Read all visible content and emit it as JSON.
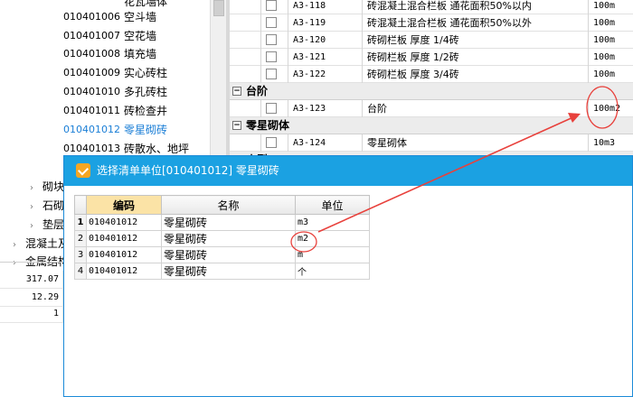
{
  "left_tree": {
    "rows": [
      {
        "code": "",
        "name": "花瓦墙体"
      },
      {
        "code": "010401006",
        "name": "空斗墙"
      },
      {
        "code": "010401007",
        "name": "空花墙"
      },
      {
        "code": "010401008",
        "name": "填充墙"
      },
      {
        "code": "010401009",
        "name": "实心砖柱"
      },
      {
        "code": "010401010",
        "name": "多孔砖柱"
      },
      {
        "code": "010401011",
        "name": "砖检查井"
      },
      {
        "code": "010401012",
        "name": "零星砌砖",
        "selected": true
      },
      {
        "code": "010401013",
        "name": "砖散水、地坪"
      }
    ],
    "nodes": [
      {
        "label": "砌块"
      },
      {
        "label": "石砌"
      },
      {
        "label": "垫层"
      },
      {
        "label": "混凝土及钢"
      },
      {
        "label": "金属结构"
      }
    ],
    "numbers": [
      "317.07",
      "12.29",
      "1"
    ]
  },
  "quota_table": {
    "rows": [
      {
        "kind": "item",
        "code": "A3-118",
        "name": "砖混凝土混合栏板 通花面积50%以内",
        "unit": "100m"
      },
      {
        "kind": "item",
        "code": "A3-119",
        "name": "砖混凝土混合栏板 通花面积50%以外",
        "unit": "100m"
      },
      {
        "kind": "item",
        "code": "A3-120",
        "name": "砖砌栏板 厚度 1/4砖",
        "unit": "100m"
      },
      {
        "kind": "item",
        "code": "A3-121",
        "name": "砖砌栏板 厚度 1/2砖",
        "unit": "100m"
      },
      {
        "kind": "item",
        "code": "A3-122",
        "name": "砖砌栏板 厚度 3/4砖",
        "unit": "100m"
      },
      {
        "kind": "group",
        "toggle": "−",
        "label": "台阶"
      },
      {
        "kind": "item",
        "code": "A3-123",
        "name": "台阶",
        "unit": "100m2"
      },
      {
        "kind": "group",
        "toggle": "−",
        "label": "零星砌体"
      },
      {
        "kind": "item",
        "code": "A3-124",
        "name": "零星砌体",
        "unit": "10m3"
      },
      {
        "kind": "group",
        "toggle": "−",
        "label": "小型"
      }
    ]
  },
  "dialog": {
    "title": "选择清单单位[010401012] 零星砌砖",
    "columns": {
      "code": "编码",
      "name": "名称",
      "unit": "单位"
    },
    "rows": [
      {
        "n": "1",
        "code": "010401012",
        "name": "零星砌砖",
        "unit": "m3"
      },
      {
        "n": "2",
        "code": "010401012",
        "name": "零星砌砖",
        "unit": "m2"
      },
      {
        "n": "3",
        "code": "010401012",
        "name": "零星砌砖",
        "unit": "m"
      },
      {
        "n": "4",
        "code": "010401012",
        "name": "零星砌砖",
        "unit": "个"
      }
    ]
  },
  "annotation": {
    "color": "#e8413c"
  }
}
